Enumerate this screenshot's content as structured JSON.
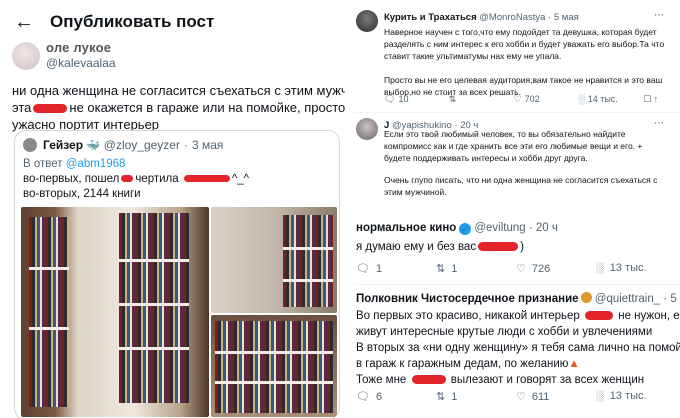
{
  "left": {
    "back_icon": "arrow-left-icon",
    "title": "Опубликовать пост",
    "author": {
      "name": "оле лукое",
      "handle": "@kalevaalaa"
    },
    "text_lines": [
      "ни одна женщина не согласится съехаться с этим мужчиной, пок",
      "эта",
      "не окажется в гараже или на помойке, просто потому ч",
      "ужасно портит интерьер"
    ],
    "quote": {
      "name": "Гейзер",
      "handle": "@zloy_geyzer",
      "date": "3 мая",
      "reply_to_label": "В ответ",
      "reply_to_handle": "@abm1968",
      "line1a": "во-первых, пошел",
      "line1b": "чертила",
      "line1c": "^_^",
      "line2": "во-вторых, 2144 книги"
    }
  },
  "right_top": {
    "tweet1": {
      "name": "Курить и Трахаться",
      "handle": "@MonroNastya",
      "date": "5 мая",
      "body1": "Наверное научен с того,что ему подойдет та девушка, которая будет разделять с ним интерес к его хобби и будет уважать его выбор.Та что ставит такие ультиматумы нах ему не упала.",
      "body2": "Просто вы не его целевая аудитория,вам такое не нравится и это ваш выбор,но не стоит за всех решать.",
      "replies": "10",
      "retweets": "",
      "likes": "702",
      "views": "14 тыс."
    },
    "tweet2": {
      "name": "J",
      "handle": "@yapishukino",
      "date": "20 ч",
      "body1": "Если это твой любимый человек, то вы обязательно найдите компромисс как и где хранить все эти его любимые вещи и его. + будете поддерживать интересы и хобби друг друга.",
      "body2": "Очень глупо писать, что ни одна женщина не согласится съехаться с этим мужчиной."
    }
  },
  "right_bottom": {
    "tweet1": {
      "name": "нормальное кино",
      "handle": "@eviltung",
      "date": "20 ч",
      "body_a": "я думаю ему и без вас",
      "body_b": ")",
      "replies": "1",
      "retweets": "1",
      "likes": "726",
      "views": "13 тыс."
    },
    "tweet2": {
      "name": "Полковник Чистосердечное признание",
      "handle": "@quiettrain_",
      "date": "5 мая",
      "line1a": "Во первых это красиво, никакой интерьер",
      "line1b": "не нужон, если в",
      "line2": "живут интересные крутые люди с хобби и увлечениями",
      "line3": "В вторых за «ни одну женщину» я тебя сама лично на помойку отв",
      "line4": "в гараж к гаражным дедам, по желанию",
      "line5a": "Тоже мне",
      "line5b": "вылезают и говорят за всех женщин",
      "replies": "6",
      "retweets": "1",
      "likes": "611",
      "views": "13 тыс."
    }
  },
  "icons": {
    "reply": "reply-icon",
    "retweet": "retweet-icon",
    "like": "heart-icon",
    "views": "views-icon",
    "more": "more-icon"
  },
  "colors": {
    "redaction": "#e3242b",
    "verified": "#1d9bf0",
    "muted": "#536471"
  }
}
